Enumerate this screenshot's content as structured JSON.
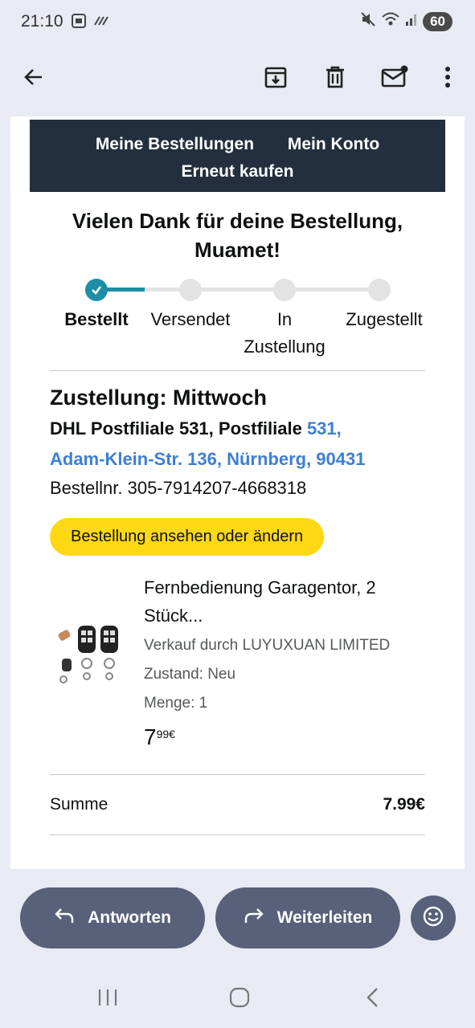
{
  "status_bar": {
    "time": "21:10",
    "battery": "60",
    "left_icons": [
      "screenshot-icon",
      "signal-wave-icon"
    ],
    "right_icons": [
      "mute-icon",
      "wifi-icon",
      "cell-signal-icon"
    ]
  },
  "app_bar": {
    "icons": [
      "back-arrow-icon",
      "archive-icon",
      "delete-icon",
      "mark-unread-icon",
      "more-vert-icon"
    ]
  },
  "email": {
    "nav": {
      "my_orders": "Meine Bestellungen",
      "my_account": "Mein Konto",
      "buy_again": "Erneut kaufen"
    },
    "thanks_line1": "Vielen Dank für deine Bestellung,",
    "thanks_line2": "Muamet!",
    "progress": {
      "completed_steps": 1,
      "steps": [
        {
          "label_line1": "Bestellt",
          "label_line2": "",
          "done": true
        },
        {
          "label_line1": "Versendet",
          "label_line2": "",
          "done": false
        },
        {
          "label_line1": "In",
          "label_line2": "Zustellung",
          "done": false
        },
        {
          "label_line1": "Zugestellt",
          "label_line2": "",
          "done": false
        }
      ]
    },
    "delivery": {
      "title": "Zustellung: Mittwoch",
      "address_plain": "DHL Postfiliale 531, Postfiliale ",
      "address_link_1": "531,",
      "address_link_2": "Adam-Klein-Str. 136, Nürnberg, 90431",
      "order_number": "Bestellnr. 305-7914207-4668318"
    },
    "view_order_button": "Bestellung ansehen oder ändern",
    "product": {
      "title_line1": "Fernbedienung Garagentor, 2",
      "title_line2": "Stück...",
      "seller": "Verkauf durch LUYUXUAN LIMITED",
      "condition": "Zustand: Neu",
      "quantity": "Menge: 1",
      "price_main": "7",
      "price_sup": "99€"
    },
    "sum": {
      "label": "Summe",
      "value": "7.99€"
    }
  },
  "actions": {
    "reply": "Antworten",
    "forward": "Weiterleiten"
  },
  "colors": {
    "nav_background": "#232f3e",
    "progress_active": "#1d8ea5",
    "button_yellow": "#ffd814",
    "link_blue": "#3d7fd6",
    "action_button": "#58607a"
  }
}
